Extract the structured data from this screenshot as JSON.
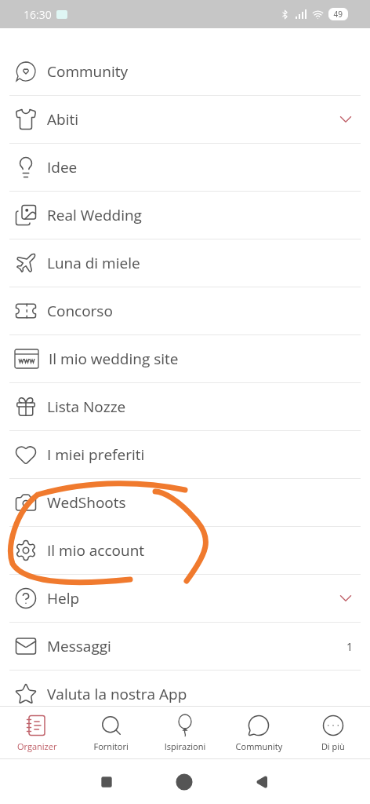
{
  "status_bar": {
    "time": "16:30",
    "battery": "49"
  },
  "menu": {
    "items": [
      {
        "label": "Community",
        "kind": "plain"
      },
      {
        "label": "Abiti",
        "kind": "group",
        "expanded": false
      },
      {
        "label": "Idee",
        "kind": "plain"
      },
      {
        "label": "Real Wedding",
        "kind": "plain"
      },
      {
        "label": "Luna di miele",
        "kind": "plain"
      },
      {
        "label": "Concorso",
        "kind": "plain"
      },
      {
        "label": "Il mio wedding site",
        "kind": "plain"
      },
      {
        "label": "Lista Nozze",
        "kind": "plain"
      },
      {
        "label": "I miei preferiti",
        "kind": "plain"
      },
      {
        "label": "WedShoots",
        "kind": "plain"
      },
      {
        "label": "Il mio account",
        "kind": "plain"
      },
      {
        "label": "Help",
        "kind": "group",
        "expanded": false
      },
      {
        "label": "Messaggi",
        "kind": "count",
        "count": "1"
      },
      {
        "label": "Valuta la nostra App",
        "kind": "plain"
      }
    ]
  },
  "bottom_nav": [
    {
      "label": "Organizer",
      "selected": true
    },
    {
      "label": "Fornitori",
      "selected": false
    },
    {
      "label": "Ispirazioni",
      "selected": false
    },
    {
      "label": "Community",
      "selected": false
    },
    {
      "label": "Di più",
      "selected": false
    }
  ]
}
